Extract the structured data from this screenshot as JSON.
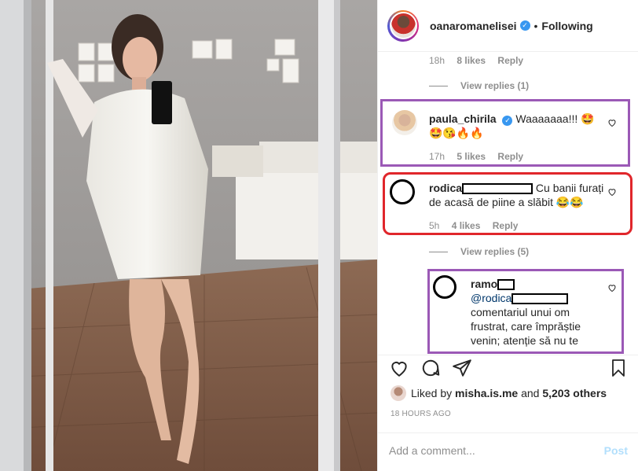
{
  "header": {
    "username": "oanaromanelisei",
    "separator": "•",
    "follow_status": "Following"
  },
  "comments": {
    "row1": {
      "time": "18h",
      "likes": "8 likes",
      "reply": "Reply"
    },
    "view_replies_1": "View replies (1)",
    "paula": {
      "user": "paula_chirila",
      "text": "Waaaaaaa!!! 🤩",
      "text2": "🤩😘🔥🔥",
      "time": "17h",
      "likes": "5 likes",
      "reply": "Reply"
    },
    "rodica": {
      "user": "rodica",
      "text": "Cu banii furați",
      "text2": "de acasă de piine a slăbit 😂😂",
      "time": "5h",
      "likes": "4 likes",
      "reply": "Reply"
    },
    "view_replies_2": "View replies (5)",
    "ramo": {
      "user": "ramo",
      "mention": "@rodica",
      "line1": "comentariul unui om",
      "line2": "frustrat, care împrăștie",
      "line3": "venin; atenție să nu te"
    }
  },
  "liked": {
    "prefix": "Liked by ",
    "user": "misha.is.me",
    "middle": " and ",
    "others": "5,203 others"
  },
  "time_ago": "18 HOURS AGO",
  "add_comment": {
    "placeholder": "Add a comment...",
    "post": "Post"
  },
  "colors": {
    "highlight_purple": "#9b59b6",
    "highlight_red": "#e0262b",
    "verified_blue": "#3897f0"
  }
}
